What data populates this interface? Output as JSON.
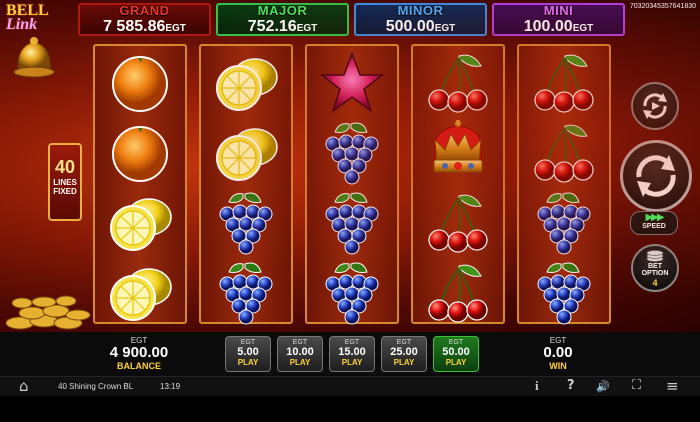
{
  "jackpots": {
    "grand": {
      "name": "GRAND",
      "value": "7 585.86",
      "unit": "EGT",
      "color": "#d02a1c"
    },
    "major": {
      "name": "MAJOR",
      "value": "752.16",
      "unit": "EGT",
      "color": "#3ad24a"
    },
    "minor": {
      "name": "MINOR",
      "value": "500.00",
      "unit": "EGT",
      "color": "#3a9ef8"
    },
    "mini": {
      "name": "MINI",
      "value": "100.00",
      "unit": "EGT",
      "color": "#d058f8"
    }
  },
  "game_id": "70320345357641830",
  "logo": {
    "line1": "BELL",
    "line2": "Link"
  },
  "lines": {
    "count": "40",
    "line1": "LINES",
    "line2": "FIXED"
  },
  "reels": [
    [
      "orange",
      "orange",
      "lemon",
      "lemon"
    ],
    [
      "lemon",
      "lemon",
      "grapes",
      "grapes"
    ],
    [
      "star",
      "grapes",
      "grapes",
      "grapes"
    ],
    [
      "cherry",
      "crown",
      "cherry",
      "cherry"
    ],
    [
      "cherry",
      "cherry",
      "grapes",
      "grapes"
    ]
  ],
  "controls": {
    "autoplay_icon": "autoplay-icon",
    "spin_icon": "spin-icon",
    "speed_label": "SPEED",
    "speed_icon": "▶▶▶",
    "bet_option_label_1": "BET",
    "bet_option_label_2": "OPTION",
    "bet_option_value": "4"
  },
  "balance": {
    "currency": "EGT",
    "value": "4 900.00",
    "label": "BALANCE"
  },
  "win": {
    "currency": "EGT",
    "value": "0.00",
    "label": "WIN"
  },
  "bets": [
    {
      "currency": "EGT",
      "value": "5.00",
      "label": "PLAY",
      "active": false
    },
    {
      "currency": "EGT",
      "value": "10.00",
      "label": "PLAY",
      "active": false
    },
    {
      "currency": "EGT",
      "value": "15.00",
      "label": "PLAY",
      "active": false
    },
    {
      "currency": "EGT",
      "value": "25.00",
      "label": "PLAY",
      "active": false
    },
    {
      "currency": "EGT",
      "value": "50.00",
      "label": "PLAY",
      "active": true
    }
  ],
  "statusbar": {
    "game_name": "40 Shining Crown BL",
    "time": "13:19",
    "home_icon": "⌂",
    "info_icon": "i",
    "help_icon": "?",
    "sound_icon": "🔊",
    "fullscreen_icon": "⛶",
    "menu_icon": "≡"
  }
}
